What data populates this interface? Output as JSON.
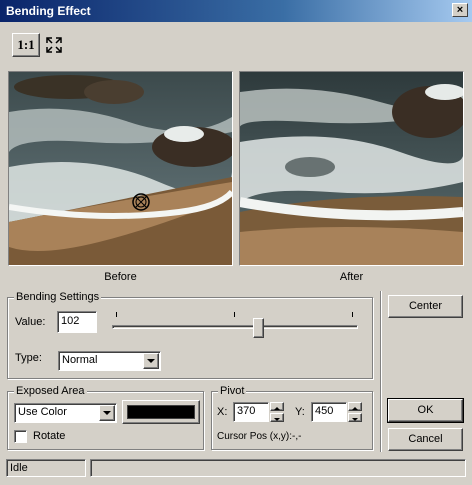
{
  "window": {
    "title": "Bending Effect",
    "close_glyph": "×"
  },
  "toolbar": {
    "zoom_label": "1:1",
    "fit_icon": "fit-to-window-icon"
  },
  "preview": {
    "before_label": "Before",
    "after_label": "After",
    "cursor_icon": "crosshair-target-icon"
  },
  "bending": {
    "group_label": "Bending Settings",
    "value_label": "Value:",
    "value": "102",
    "slider_fraction": 0.6,
    "type_label": "Type:",
    "type_selected": "Normal"
  },
  "exposed": {
    "group_label": "Exposed Area",
    "mode_selected": "Use Color",
    "swatch_color": "#000000",
    "rotate_label": "Rotate"
  },
  "pivot": {
    "group_label": "Pivot",
    "x_label": "X:",
    "x_value": "370",
    "y_label": "Y:",
    "y_value": "450",
    "cursor_pos": "Cursor Pos (x,y):-,-"
  },
  "buttons": {
    "center": "Center",
    "ok": "OK",
    "cancel": "Cancel"
  },
  "status": {
    "text": "Idle"
  }
}
